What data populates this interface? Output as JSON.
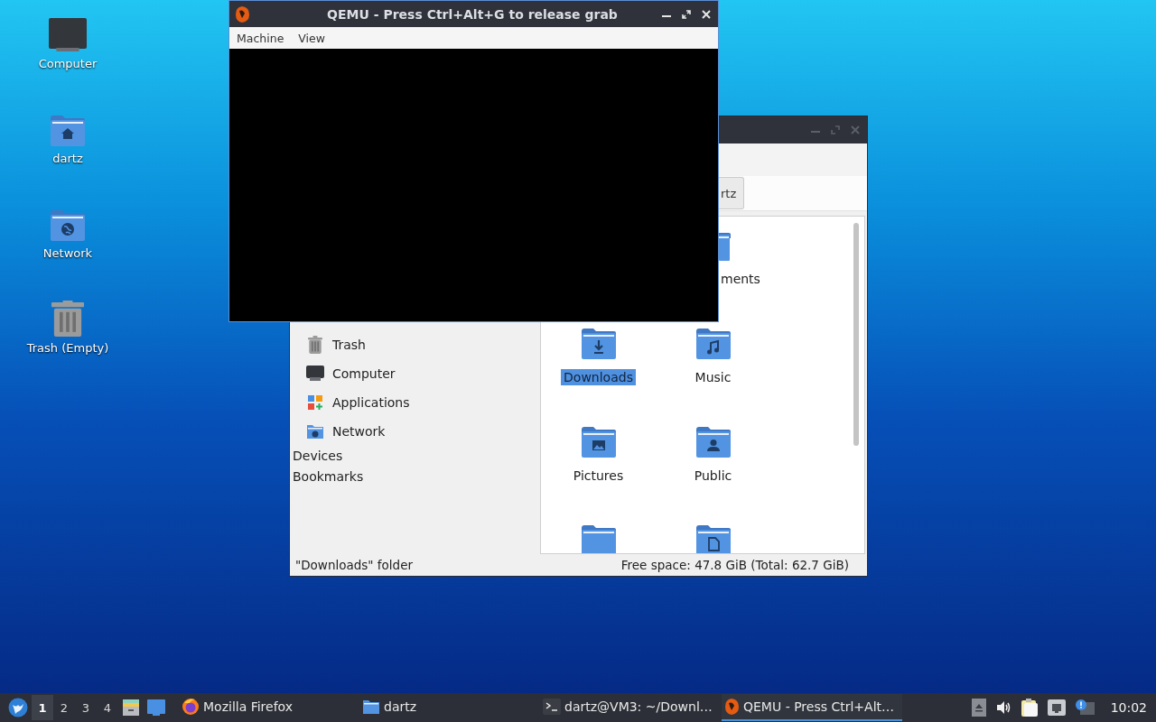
{
  "desktop_icons": [
    {
      "label": "Computer",
      "kind": "computer"
    },
    {
      "label": "dartz",
      "kind": "home"
    },
    {
      "label": "Network",
      "kind": "network"
    },
    {
      "label": "Trash (Empty)",
      "kind": "trash"
    }
  ],
  "file_manager": {
    "path_buttons": [
      "rtz"
    ],
    "places": [
      {
        "label": "Trash",
        "kind": "trash"
      },
      {
        "label": "Computer",
        "kind": "computer"
      },
      {
        "label": "Applications",
        "kind": "apps"
      },
      {
        "label": "Network",
        "kind": "network"
      }
    ],
    "sections": [
      "Devices",
      "Bookmarks"
    ],
    "items": [
      {
        "kind": "empty"
      },
      {
        "kind": "cut",
        "label": "ments",
        "selected": false
      },
      {
        "kind": "download",
        "label": "Downloads",
        "selected": true
      },
      {
        "kind": "music",
        "label": "Music",
        "selected": false
      },
      {
        "kind": "picture",
        "label": "Pictures",
        "selected": false
      },
      {
        "kind": "person",
        "label": "Public",
        "selected": false
      },
      {
        "kind": "plain",
        "selected": false
      },
      {
        "kind": "document",
        "selected": false
      }
    ],
    "status_bar": {
      "left": "\"Downloads\" folder",
      "right": "Free space: 47.8 GiB (Total: 62.7 GiB)"
    }
  },
  "qemu_window": {
    "title": "QEMU - Press Ctrl+Alt+G to release grab",
    "menu": [
      "Machine",
      "View"
    ]
  },
  "taskbar": {
    "workspaces": [
      {
        "label": "1",
        "selected": true
      },
      {
        "label": "2",
        "selected": false
      },
      {
        "label": "3",
        "selected": false
      },
      {
        "label": "4",
        "selected": false
      }
    ],
    "tasks": [
      {
        "label": "Mozilla Firefox",
        "kind": "firefox",
        "selected": false
      },
      {
        "label": "dartz",
        "kind": "folder",
        "selected": false
      },
      {
        "label": "dartz@VM3: ~/Downl…",
        "kind": "terminal",
        "selected": false
      },
      {
        "label": "QEMU - Press Ctrl+Alt…",
        "kind": "qemu",
        "selected": true
      }
    ],
    "clock": "10:02"
  }
}
